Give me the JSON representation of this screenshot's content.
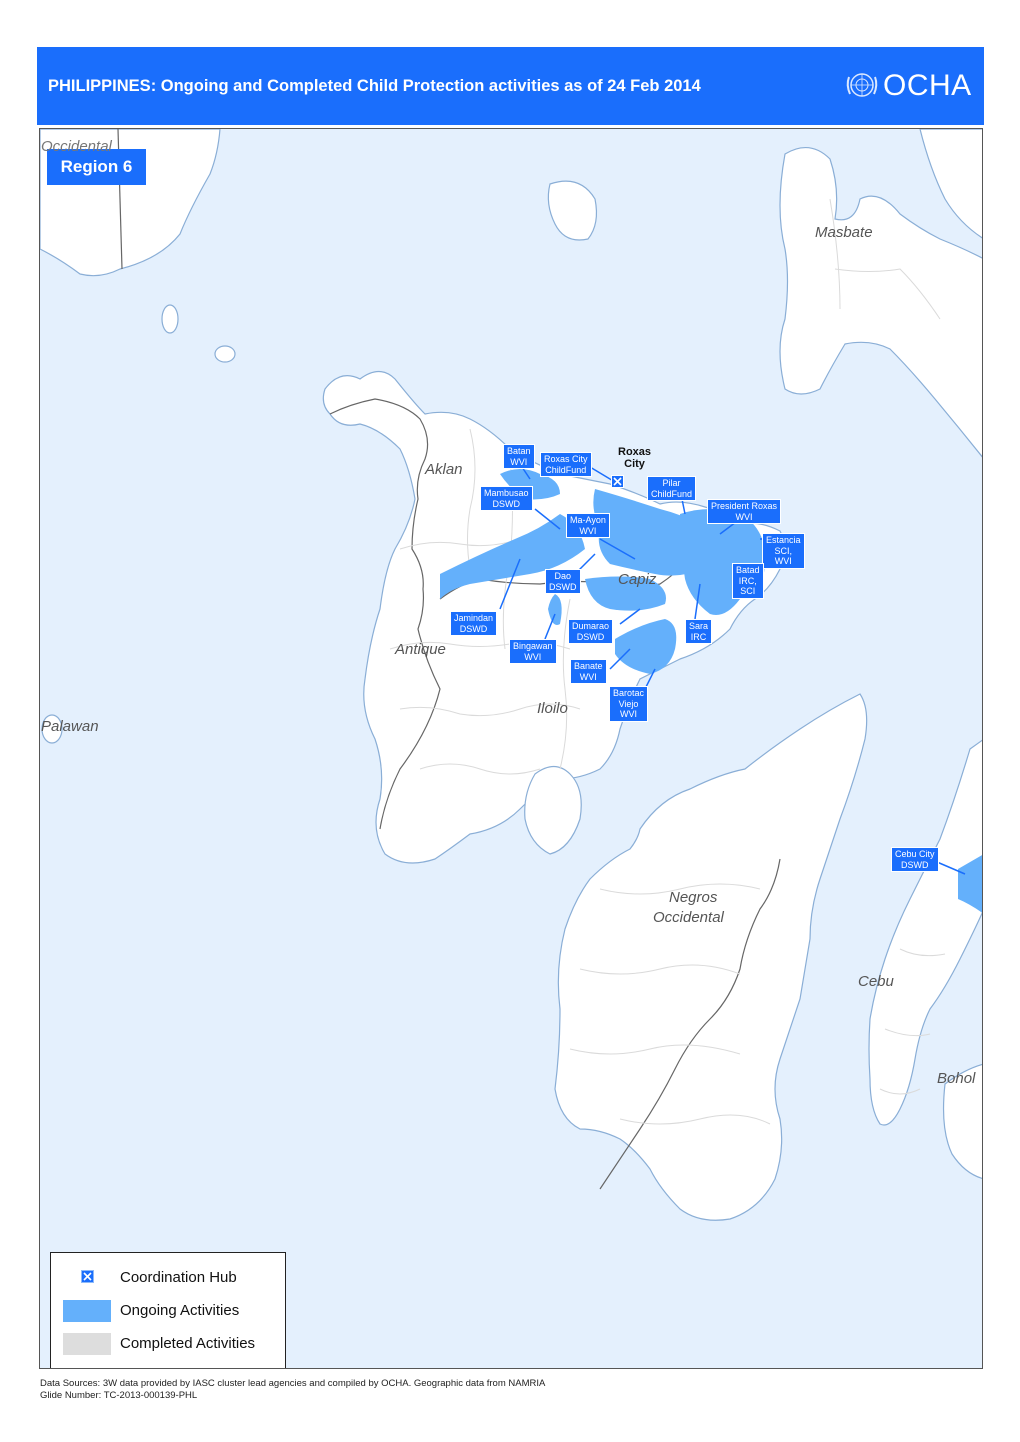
{
  "header": {
    "title": "PHILIPPINES: Ongoing and Completed Child Protection activities as of 24 Feb 2014",
    "logo_text": "OCHA",
    "logo_icon": "un-emblem-icon",
    "background_color": "#1a6efc"
  },
  "map": {
    "region_label": "Region 6",
    "colors": {
      "sea": "#e4f0fd",
      "land": "#ffffff",
      "coast": "#8aaed6",
      "ongoing": "#64b0fb",
      "callout": "#1a6efc",
      "completed": "#dddddd"
    },
    "province_labels": [
      "Occidental",
      "Masbate",
      "Aklan",
      "Capiz",
      "Antique",
      "Iloilo",
      "Palawan",
      "Negros",
      "Occidental",
      "Cebu",
      "Bohol"
    ],
    "hub": {
      "name": "Roxas City",
      "line1": "Roxas",
      "line2": "City",
      "icon": "coordination-hub-icon"
    },
    "callouts": [
      {
        "line1": "Batan",
        "line2": "WVI",
        "line3": ""
      },
      {
        "line1": "Roxas City",
        "line2": "ChildFund",
        "line3": ""
      },
      {
        "line1": "Mambusao",
        "line2": "DSWD",
        "line3": ""
      },
      {
        "line1": "Pilar",
        "line2": "ChildFund",
        "line3": ""
      },
      {
        "line1": "President Roxas",
        "line2": "WVI",
        "line3": ""
      },
      {
        "line1": "Ma-Ayon",
        "line2": "WVI",
        "line3": ""
      },
      {
        "line1": "Estancia",
        "line2": "SCI,",
        "line3": "WVI"
      },
      {
        "line1": "Batad",
        "line2": "IRC,",
        "line3": "SCI"
      },
      {
        "line1": "Dao",
        "line2": "DSWD",
        "line3": ""
      },
      {
        "line1": "Jamindan",
        "line2": "DSWD",
        "line3": ""
      },
      {
        "line1": "Dumarao",
        "line2": "DSWD",
        "line3": ""
      },
      {
        "line1": "Sara",
        "line2": "IRC",
        "line3": ""
      },
      {
        "line1": "Bingawan",
        "line2": "WVI",
        "line3": ""
      },
      {
        "line1": "Banate",
        "line2": "WVI",
        "line3": ""
      },
      {
        "line1": "Barotac",
        "line2": "Viejo",
        "line3": "WVI"
      },
      {
        "line1": "Cebu City",
        "line2": "DSWD",
        "line3": ""
      }
    ]
  },
  "legend": {
    "items": [
      {
        "label": "Coordination Hub",
        "icon": "coordination-hub-icon"
      },
      {
        "label": "Ongoing Activities",
        "color": "#64b0fb"
      },
      {
        "label": "Completed Activities",
        "color": "#dddddd"
      }
    ]
  },
  "footer": {
    "sources": "Data Sources:  3W data provided by IASC cluster lead agencies and compiled by OCHA.  Geographic data from NAMRIA",
    "glide": "Glide Number: TC-2013-000139-PHL"
  }
}
